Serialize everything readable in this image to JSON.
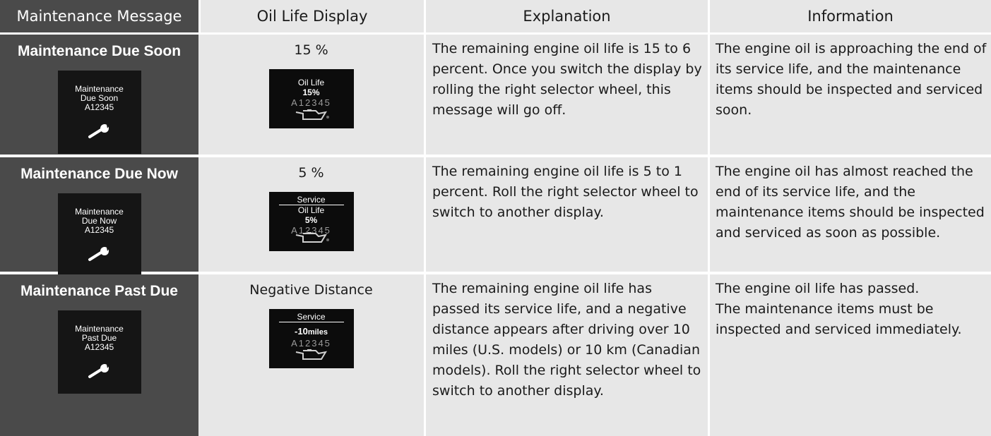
{
  "header": {
    "col1": "Maintenance Message",
    "col2": "Oil Life Display",
    "col3": "Explanation",
    "col4": "Information"
  },
  "rows": [
    {
      "title": "Maintenance Due Soon",
      "screen_lines": [
        "Maintenance",
        "Due Soon",
        "A12345"
      ],
      "screen_icon": "wrench-icon",
      "oil_label": "15 %",
      "oil_screen": {
        "header": "",
        "line1": "Oil Life",
        "line2": "15%",
        "code": "A12345",
        "icon": "oil-can-icon"
      },
      "explanation": "The remaining engine oil life is 15 to 6 percent. Once you switch the display by rolling the right selector wheel, this message will go off.",
      "information": "The engine oil is approaching the end of its service life, and the maintenance items should be inspected and serviced soon."
    },
    {
      "title": "Maintenance Due Now",
      "screen_lines": [
        "Maintenance",
        "Due Now",
        "A12345"
      ],
      "screen_icon": "wrench-icon",
      "oil_label": "5 %",
      "oil_screen": {
        "header": "Service",
        "line1": "Oil Life",
        "line2": "5%",
        "code": "A12345",
        "icon": "oil-can-icon"
      },
      "explanation": "The remaining engine oil life is 5 to 1 percent. Roll the right selector wheel to switch to another display.",
      "information": "The engine oil has almost reached the end of its service life, and the maintenance items should be inspected and serviced as soon as possible."
    },
    {
      "title": "Maintenance Past Due",
      "screen_lines": [
        "Maintenance",
        "Past Due",
        "A12345"
      ],
      "screen_icon": "wrench-icon",
      "oil_label": "Negative Distance",
      "oil_screen": {
        "header": "Service",
        "distance": "-10",
        "unit": "miles",
        "code": "A12345",
        "icon": "oil-can-icon"
      },
      "explanation": "The remaining engine oil life has passed its service life, and a negative distance appears after driving over 10 miles (U.S. models) or 10 km (Canadian models). Roll the right selector wheel to switch to another display.",
      "information_lines": [
        "The engine oil life has passed.",
        "The maintenance items must be inspected and serviced immediately."
      ]
    }
  ]
}
